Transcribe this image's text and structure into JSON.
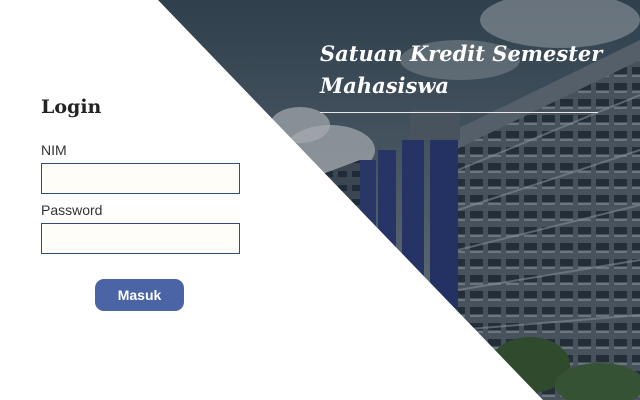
{
  "login": {
    "title": "Login",
    "nim_label": "NIM",
    "nim_value": "",
    "password_label": "Password",
    "password_value": "",
    "submit_label": "Masuk"
  },
  "hero": {
    "title": "Satuan Kredit Semester Mahasiswa"
  },
  "colors": {
    "button": "#4a64a6",
    "input_border": "#2f4f78",
    "panel": "#ffffff"
  }
}
